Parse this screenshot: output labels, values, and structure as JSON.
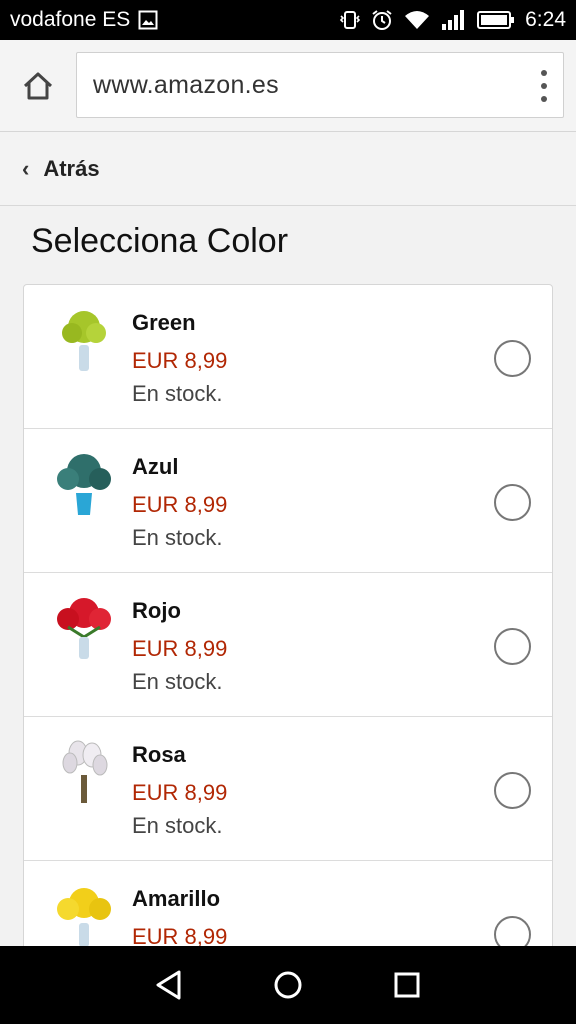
{
  "status_bar": {
    "carrier": "vodafone ES",
    "time": "6:24",
    "icons": [
      "image-icon",
      "vibrate-icon",
      "alarm-icon",
      "wifi-icon",
      "signal-icon",
      "battery-icon"
    ]
  },
  "browser": {
    "url": "www.amazon.es",
    "icons": [
      "home-icon",
      "overflow-menu-icon"
    ]
  },
  "nav": {
    "back_label": "Atrás"
  },
  "page": {
    "title": "Selecciona Color",
    "items": [
      {
        "name": "Green",
        "price": "EUR 8,99",
        "stock": "En stock.",
        "flower_color": "#a6c62a",
        "vase_color": "#c9dbe8"
      },
      {
        "name": "Azul",
        "price": "EUR 8,99",
        "stock": "En stock.",
        "flower_color": "#2f6f6b",
        "vase_color": "#2aa6d6"
      },
      {
        "name": "Rojo",
        "price": "EUR 8,99",
        "stock": "En stock.",
        "flower_color": "#d6182a",
        "vase_color": "#c9dbe8"
      },
      {
        "name": "Rosa",
        "price": "EUR 8,99",
        "stock": "En stock.",
        "flower_color": "#e8e4ea",
        "vase_color": "#6b5a3a"
      },
      {
        "name": "Amarillo",
        "price": "EUR 8,99",
        "stock": "",
        "flower_color": "#f2cf1a",
        "vase_color": "#c9dbe8"
      }
    ]
  },
  "colors": {
    "price": "#b12704",
    "status_bar_bg": "#000000"
  },
  "system_nav": {
    "icons": [
      "back-triangle-icon",
      "home-circle-icon",
      "recents-square-icon"
    ]
  }
}
